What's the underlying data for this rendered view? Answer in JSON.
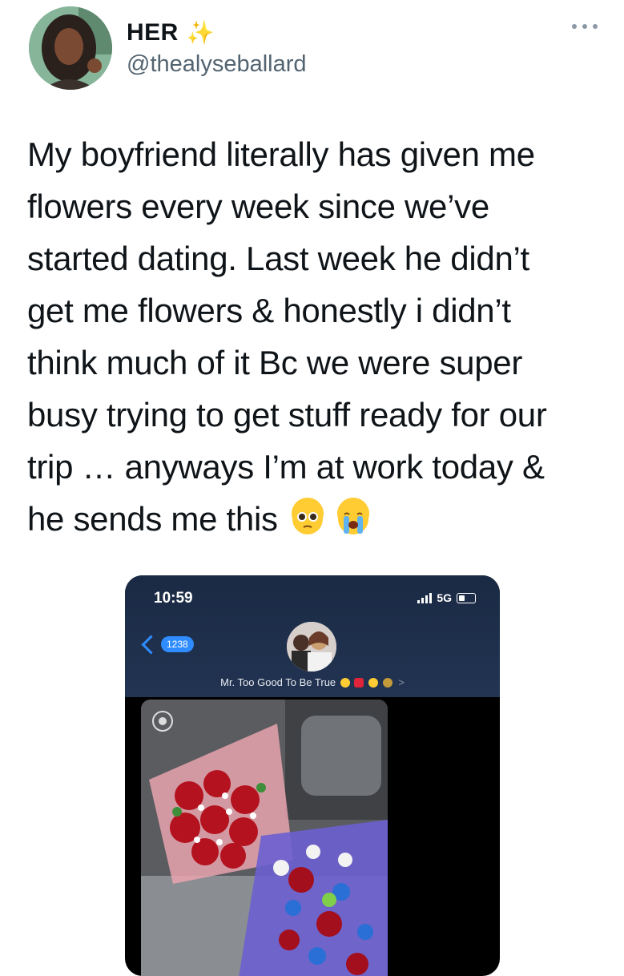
{
  "author": {
    "display_name": "HER",
    "handle": "@thealyseballard",
    "name_emoji": "✨"
  },
  "tweet": {
    "lines": [
      "My boyfriend literally has given me",
      "flowers every week since we’ve",
      "started dating.  Last week he didn’t",
      "get me flowers & honestly i didn’t",
      "think much of it Bc we were super",
      "busy trying to get stuff ready for our",
      "trip … anyways I’m at work  today &",
      "he sends me this"
    ],
    "emojis": [
      "pleading-face",
      "loudly-crying-face"
    ]
  },
  "screenshot": {
    "time": "10:59",
    "network": "5G",
    "back_count": "1238",
    "contact_name": "Mr. Too Good To Be True",
    "contact_emojis": [
      "pleading-face",
      "red-heart",
      "crying-face",
      "money-bag"
    ],
    "chevron": ">"
  },
  "colors": {
    "text": "#0f1419",
    "secondary": "#536471",
    "ios_blue": "#2f8cff",
    "header_bg": "#1f3050"
  },
  "icons": [
    "more-options-icon",
    "sparkles-icon",
    "signal-bars-icon",
    "battery-icon",
    "back-chevron-icon",
    "live-photo-icon"
  ]
}
